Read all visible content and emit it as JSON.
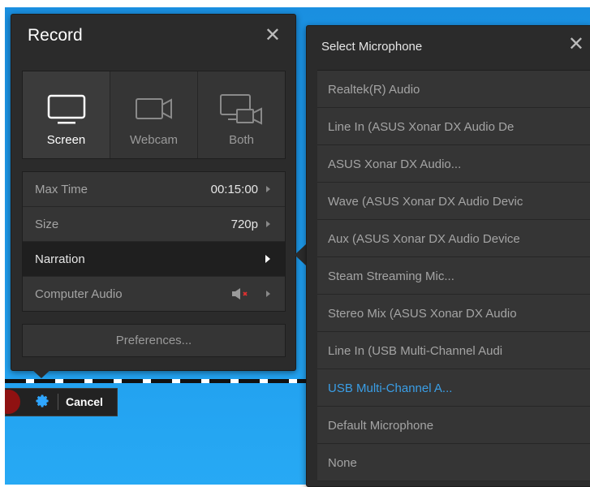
{
  "record_panel": {
    "title": "Record",
    "sources": [
      {
        "label": "Screen",
        "icon": "monitor-icon",
        "active": true
      },
      {
        "label": "Webcam",
        "icon": "webcam-icon",
        "active": false
      },
      {
        "label": "Both",
        "icon": "monitor-webcam-icon",
        "active": false
      }
    ],
    "options": [
      {
        "label": "Max Time",
        "value": "00:15:00"
      },
      {
        "label": "Size",
        "value": "720p"
      },
      {
        "label": "Narration",
        "value": ""
      },
      {
        "label": "Computer Audio",
        "value": "",
        "icon": "speaker-muted-icon"
      }
    ],
    "preferences_label": "Preferences..."
  },
  "record_bar": {
    "cancel_label": "Cancel"
  },
  "mic_panel": {
    "title": "Select Microphone",
    "items": [
      "Realtek(R) Audio",
      "Line In (ASUS Xonar DX Audio De",
      "ASUS Xonar DX Audio...",
      "Wave (ASUS Xonar DX Audio Devic",
      "Aux (ASUS Xonar DX Audio Device",
      "Steam Streaming Mic...",
      "Stereo Mix (ASUS Xonar DX Audio",
      "Line In (USB Multi-Channel Audi",
      "USB Multi-Channel A...",
      "Default Microphone",
      "None"
    ],
    "selected": "USB Multi-Channel A..."
  },
  "colors": {
    "accent": "#3a9ee6",
    "panel": "#2b2b2b",
    "desktop": "#1e9bec",
    "record": "#8f1111"
  }
}
